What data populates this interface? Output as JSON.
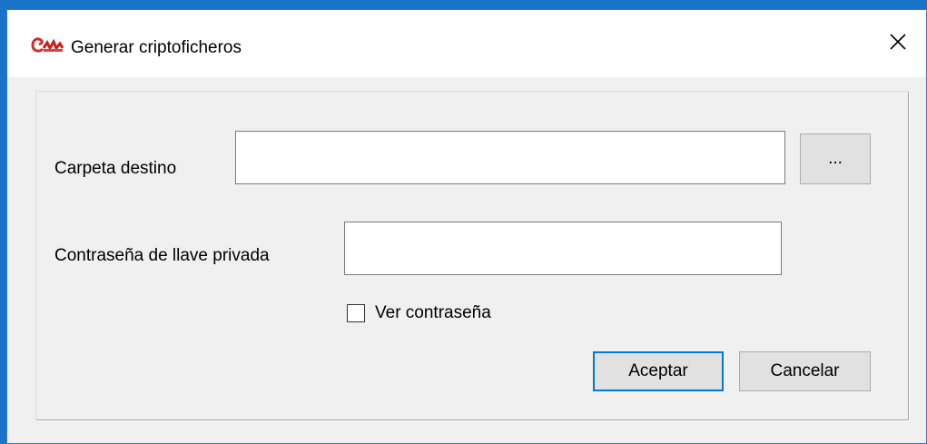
{
  "window": {
    "title": "Generar criptoficheros",
    "icon": "app-logo-icon",
    "close_glyph": "✕"
  },
  "form": {
    "folder_label": "Carpeta destino",
    "folder_value": "",
    "browse_label": "...",
    "password_label": "Contraseña de llave privada",
    "password_value": "",
    "show_password_label": "Ver contraseña",
    "show_password_checked": false
  },
  "buttons": {
    "ok_label": "Aceptar",
    "cancel_label": "Cancelar"
  },
  "colors": {
    "accent": "#0078d7",
    "window_bg": "#f0f0f0",
    "desktop": "#1a73c9"
  }
}
